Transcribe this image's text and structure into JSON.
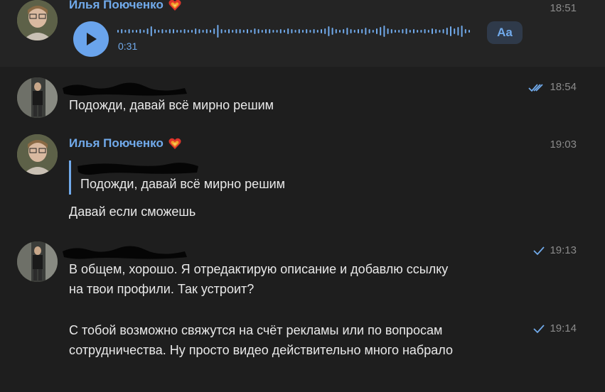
{
  "messages": [
    {
      "author": "Илья Поюченко",
      "time": "18:51",
      "voice": {
        "duration": "0:31",
        "transcribe_label": "Aa"
      }
    },
    {
      "author": "",
      "time": "18:54",
      "status": "read",
      "text": "Подожди, давай всё мирно решим"
    },
    {
      "author": "Илья Поюченко",
      "time": "19:03",
      "reply_quote": "Подожди, давай всё мирно решим",
      "text": "Давай если сможешь"
    },
    {
      "author": "",
      "time": "19:13",
      "status": "sent",
      "text_lines": [
        "В общем, хорошо. Я отредактирую описание и добавлю ссылку",
        "на твои профили. Так устроит?"
      ]
    },
    {
      "time": "19:14",
      "status": "sent",
      "text_lines": [
        "С тобой возможно свяжутся на счёт рекламы или по вопросам",
        "сотрудничества. Ну просто видео действительно много набрало"
      ]
    }
  ],
  "colors": {
    "background": "#1e1e1e",
    "accent": "#71aaeb",
    "play_button": "#6aa4ec",
    "text": "#e9e9e9",
    "time": "#8b8b8b"
  },
  "icons": [
    "heart-fire-icon",
    "play-icon",
    "double-check-icon",
    "check-icon"
  ]
}
